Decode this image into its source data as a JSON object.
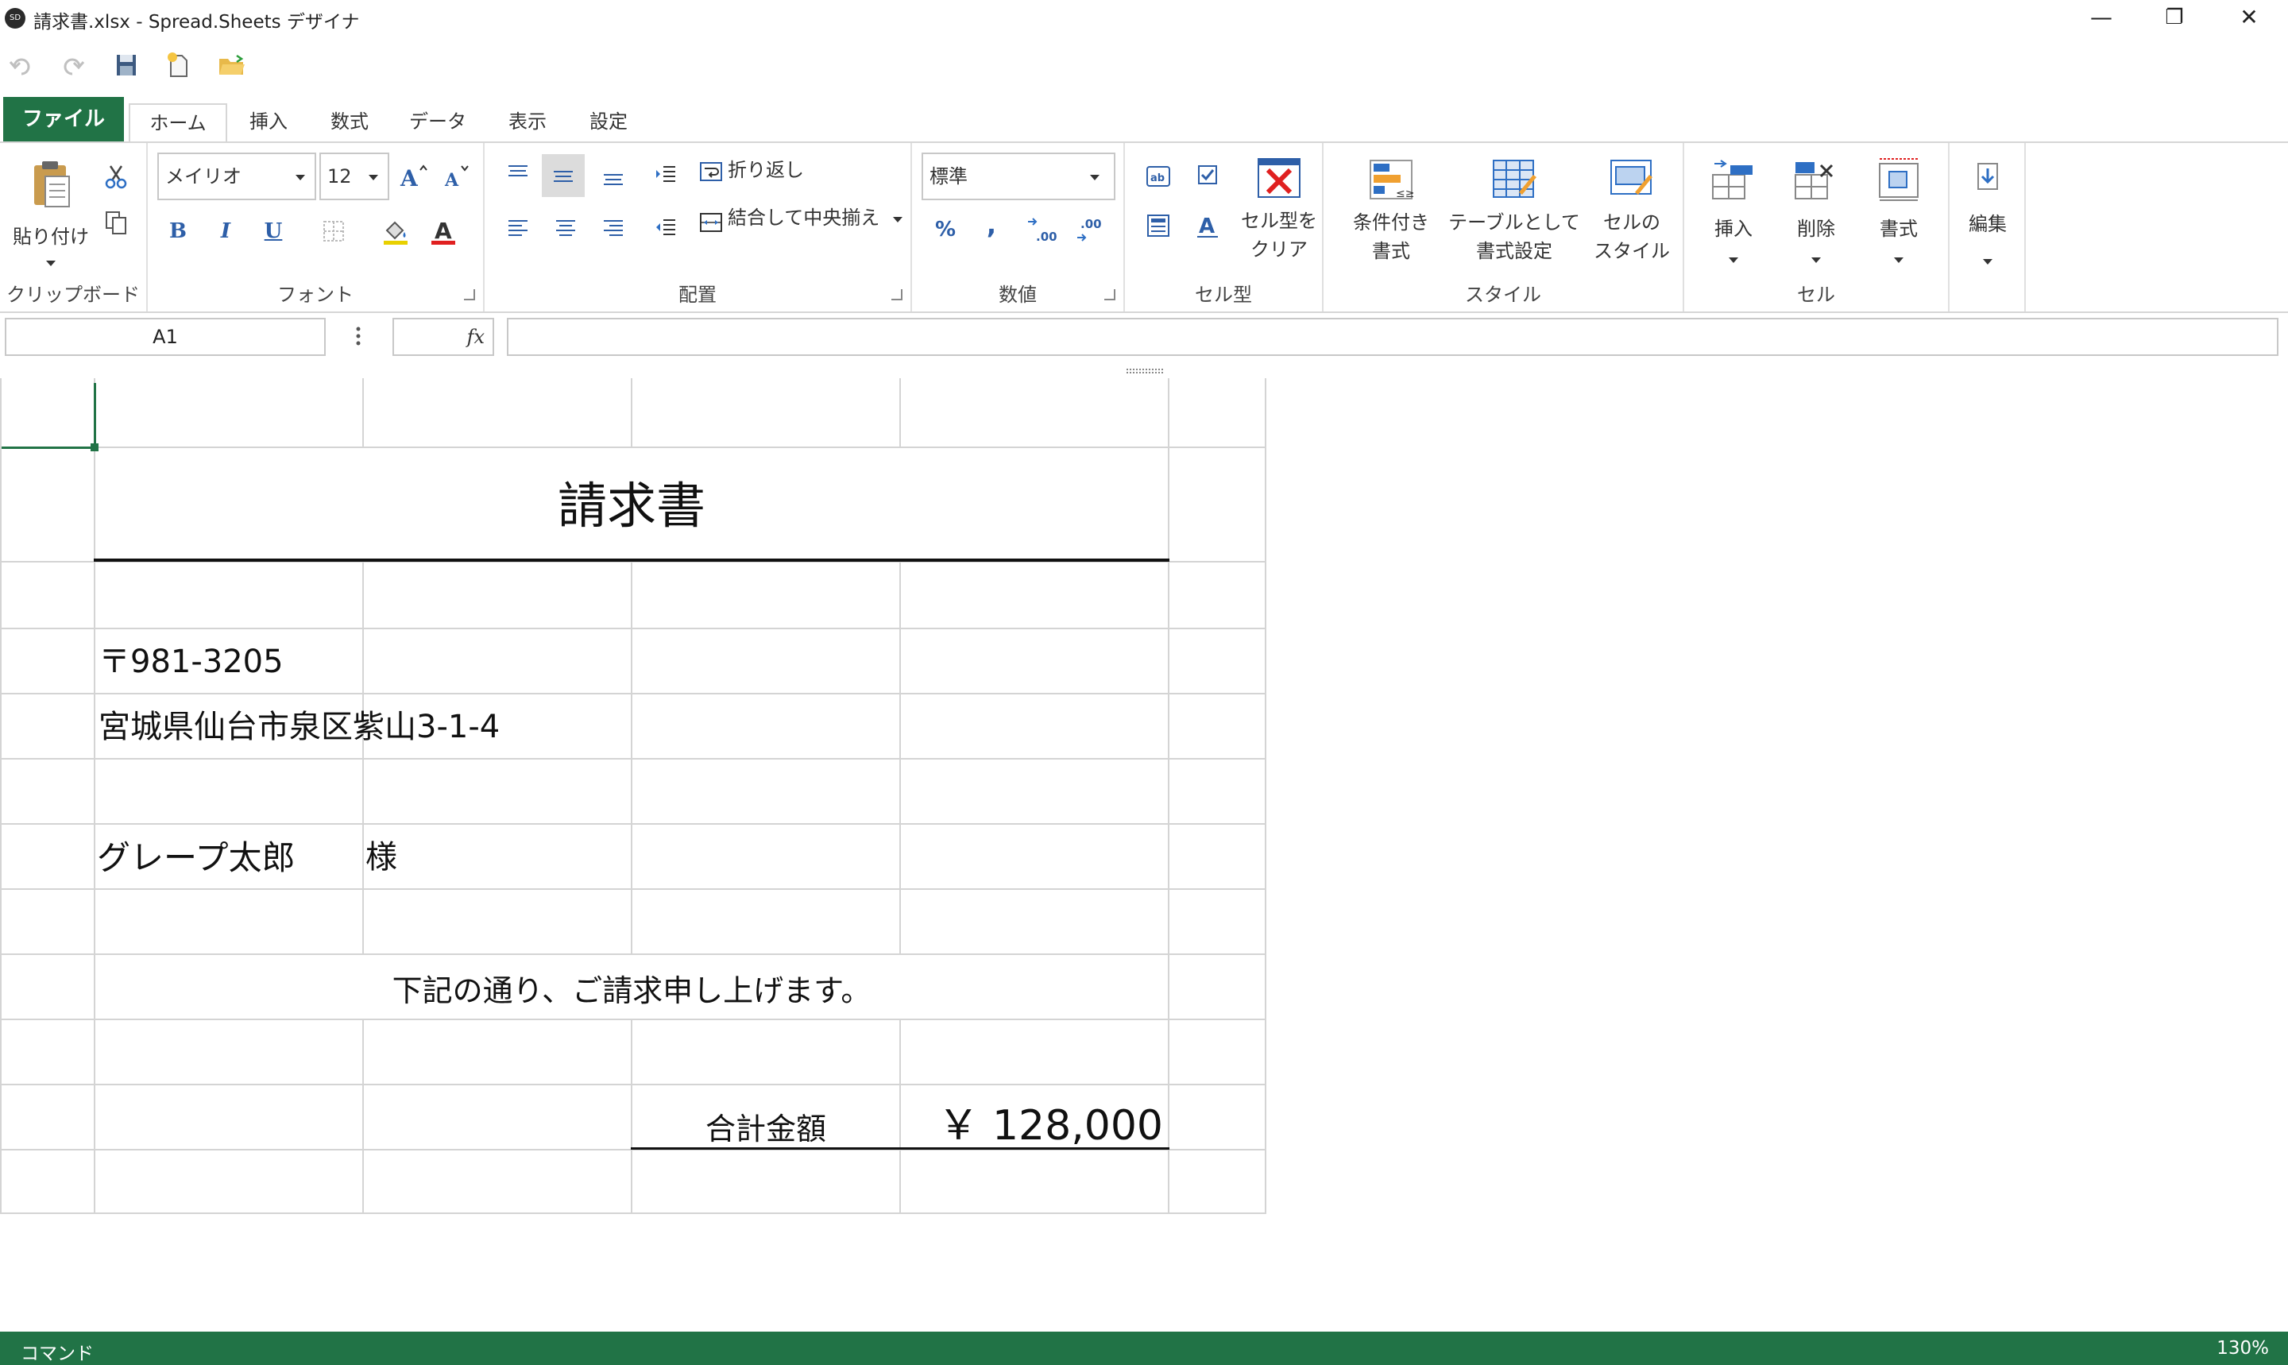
{
  "window": {
    "title": "請求書.xlsx - Spread.Sheets デザイナ",
    "app_icon_text": "SD",
    "minimize": "—",
    "restore": "❐",
    "close": "✕"
  },
  "tabs": [
    {
      "label": "ファイル"
    },
    {
      "label": "ホーム"
    },
    {
      "label": "挿入"
    },
    {
      "label": "数式"
    },
    {
      "label": "データ"
    },
    {
      "label": "表示"
    },
    {
      "label": "設定"
    }
  ],
  "ribbon": {
    "clipboard": {
      "label": "クリップボード",
      "paste": "貼り付け"
    },
    "font": {
      "label": "フォント",
      "family": "メイリオ",
      "size": "12",
      "bold": "B",
      "italic": "I",
      "underline": "U"
    },
    "alignment": {
      "label": "配置",
      "wrap": "折り返し",
      "merge": "結合して中央揃え"
    },
    "number": {
      "label": "数値",
      "format": "標準",
      "percent": "%",
      "comma": ",",
      "inc_decimal": ".00",
      "dec_decimal": ".00"
    },
    "celltype": {
      "label": "セル型",
      "clear_line1": "セル型を",
      "clear_line2": "クリア"
    },
    "styles": {
      "label": "スタイル",
      "conditional_line1": "条件付き",
      "conditional_line2": "書式",
      "table_line1": "テーブルとして",
      "table_line2": "書式設定",
      "cellstyle_line1": "セルの",
      "cellstyle_line2": "スタイル"
    },
    "cells": {
      "label": "セル",
      "insert": "挿入",
      "delete": "削除",
      "format": "書式"
    },
    "editing": {
      "label": "編集"
    }
  },
  "formula_bar": {
    "name_box": "A1",
    "fx": "fx",
    "formula": ""
  },
  "sheet": {
    "title": "請求書",
    "postal": "〒981-3205",
    "address": "宮城県仙台市泉区紫山3-1-4",
    "customer": "グレープ太郎",
    "honorific": "様",
    "message": "下記の通り、ご請求申し上げます。",
    "total_label": "合計金額",
    "total_value": "￥ 128,000"
  },
  "status": {
    "left": "コマンド",
    "zoom": "130%"
  },
  "colors": {
    "accent": "#217346",
    "red_x": "#e02020",
    "icon_blue": "#2e6fc4"
  }
}
